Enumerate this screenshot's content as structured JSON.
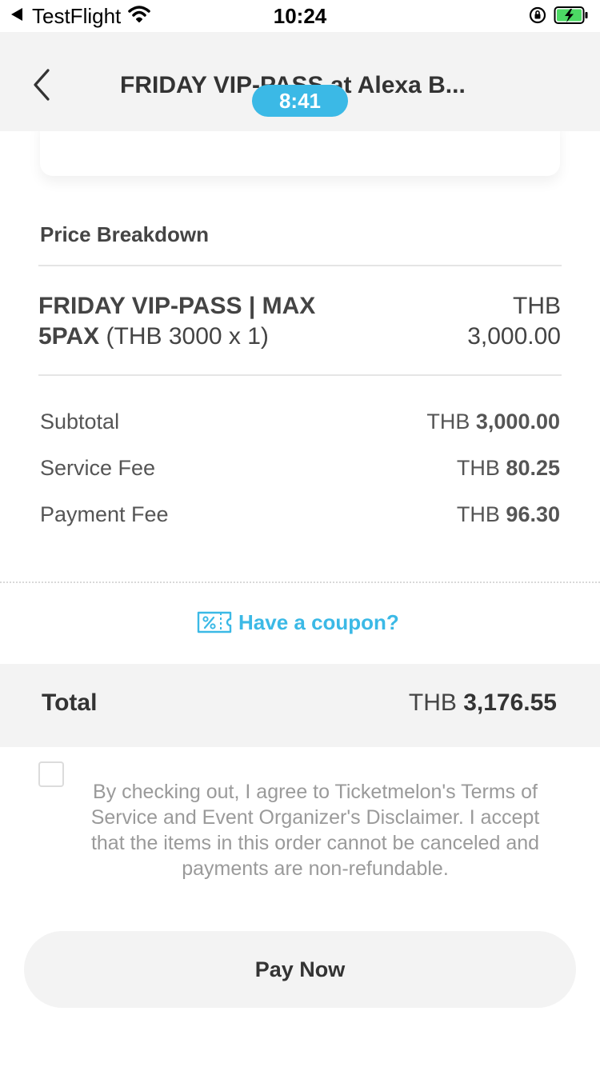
{
  "status_bar": {
    "carrier": "TestFlight",
    "time": "10:24"
  },
  "header": {
    "title": "FRIDAY VIP-PASS at Alexa B...",
    "timer": "8:41"
  },
  "price_breakdown": {
    "title": "Price Breakdown",
    "item": {
      "name_bold": "FRIDAY VIP-PASS | MAX 5PAX",
      "name_detail": "(THB 3000 x 1)",
      "currency": "THB",
      "amount": "3,000.00"
    },
    "rows": [
      {
        "label": "Subtotal",
        "currency": "THB",
        "amount": "3,000.00"
      },
      {
        "label": "Service Fee",
        "currency": "THB",
        "amount": "80.25"
      },
      {
        "label": "Payment Fee",
        "currency": "THB",
        "amount": "96.30"
      }
    ]
  },
  "coupon": {
    "label": "Have a coupon?"
  },
  "total": {
    "label": "Total",
    "currency": "THB",
    "amount": "3,176.55"
  },
  "terms": {
    "text": "By checking out, I agree to Ticketmelon's Terms of Service and Event Organizer's Disclaimer. I accept that the items in this order cannot be canceled and payments are non-refundable."
  },
  "pay_button": {
    "label": "Pay Now"
  },
  "colors": {
    "accent": "#3bb9e6",
    "header_bg": "#f3f3f3",
    "text": "#333333",
    "muted": "#9a9a9a"
  },
  "icons": {
    "status_back": "back-arrow-icon",
    "wifi": "wifi-icon",
    "lock": "rotation-lock-icon",
    "battery": "battery-charging-icon",
    "nav_back": "chevron-left-icon",
    "coupon": "coupon-percent-icon"
  }
}
